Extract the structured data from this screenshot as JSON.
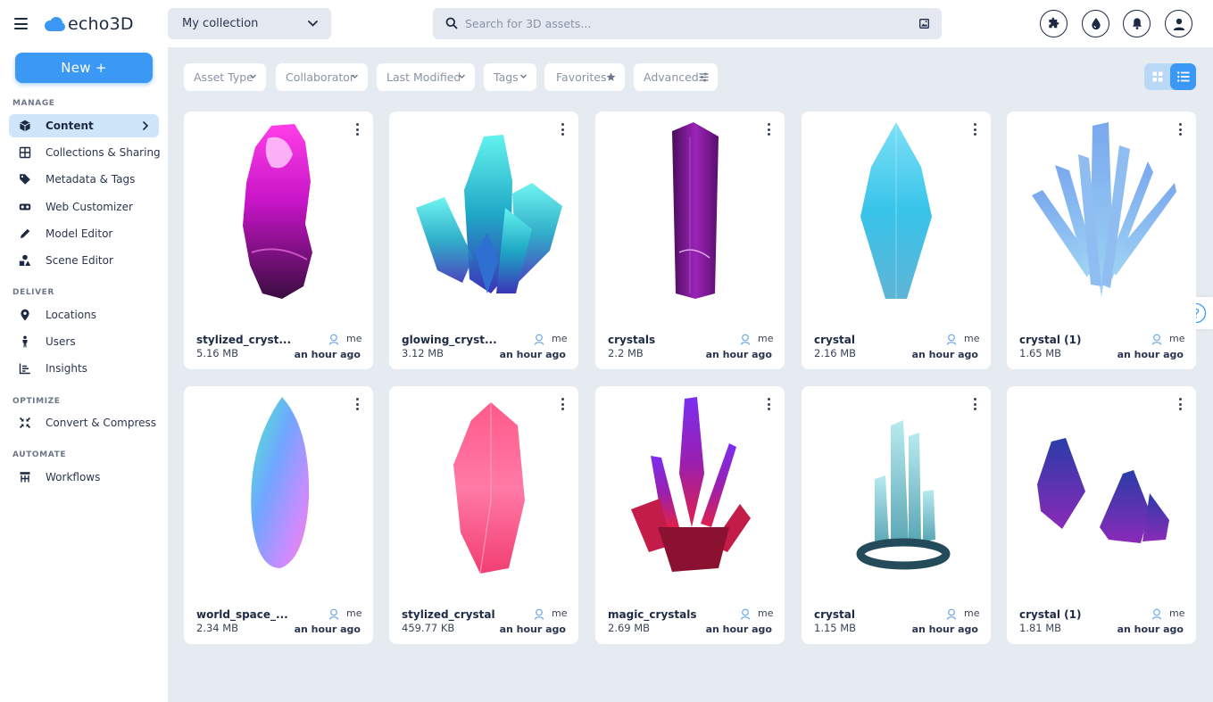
{
  "app": {
    "logo_text": "echo3D",
    "brand_color": "#3b98f5"
  },
  "header": {
    "collection_value": "My collection",
    "search_placeholder": "Search for 3D assets...",
    "icons": [
      "puzzle-icon",
      "droplet-icon",
      "bell-icon",
      "user-icon"
    ]
  },
  "sidebar": {
    "new_button": "New +",
    "sections": {
      "manage": "MANAGE",
      "deliver": "DELIVER",
      "optimize": "OPTIMIZE",
      "automate": "AUTOMATE"
    },
    "items": {
      "content": "Content",
      "collections": "Collections & Sharing",
      "metadata": "Metadata & Tags",
      "web_customizer": "Web Customizer",
      "model_editor": "Model Editor",
      "scene_editor": "Scene Editor",
      "locations": "Locations",
      "users": "Users",
      "insights": "Insights",
      "convert": "Convert & Compress",
      "workflows": "Workflows"
    },
    "active_item": "Content"
  },
  "filters": {
    "asset_type": "Asset Type",
    "collaborator": "Collaborator",
    "last_modified": "Last Modified",
    "tags": "Tags",
    "favorites": "Favorites",
    "advanced": "Advanced"
  },
  "view_mode": "grid",
  "assets": [
    {
      "name": "stylized_cryst...",
      "size": "5.16 MB",
      "owner": "me",
      "modified": "an hour ago"
    },
    {
      "name": "glowing_cryst...",
      "size": "3.12 MB",
      "owner": "me",
      "modified": "an hour ago"
    },
    {
      "name": "crystals",
      "size": "2.2 MB",
      "owner": "me",
      "modified": "an hour ago"
    },
    {
      "name": "crystal",
      "size": "2.16 MB",
      "owner": "me",
      "modified": "an hour ago"
    },
    {
      "name": "crystal (1)",
      "size": "1.65 MB",
      "owner": "me",
      "modified": "an hour ago"
    },
    {
      "name": "world_space_...",
      "size": "2.34 MB",
      "owner": "me",
      "modified": "an hour ago"
    },
    {
      "name": "stylized_crystal",
      "size": "459.77 KB",
      "owner": "me",
      "modified": "an hour ago"
    },
    {
      "name": "magic_crystals",
      "size": "2.69 MB",
      "owner": "me",
      "modified": "an hour ago"
    },
    {
      "name": "crystal",
      "size": "1.15 MB",
      "owner": "me",
      "modified": "an hour ago"
    },
    {
      "name": "crystal (1)",
      "size": "1.81 MB",
      "owner": "me",
      "modified": "an hour ago"
    }
  ]
}
